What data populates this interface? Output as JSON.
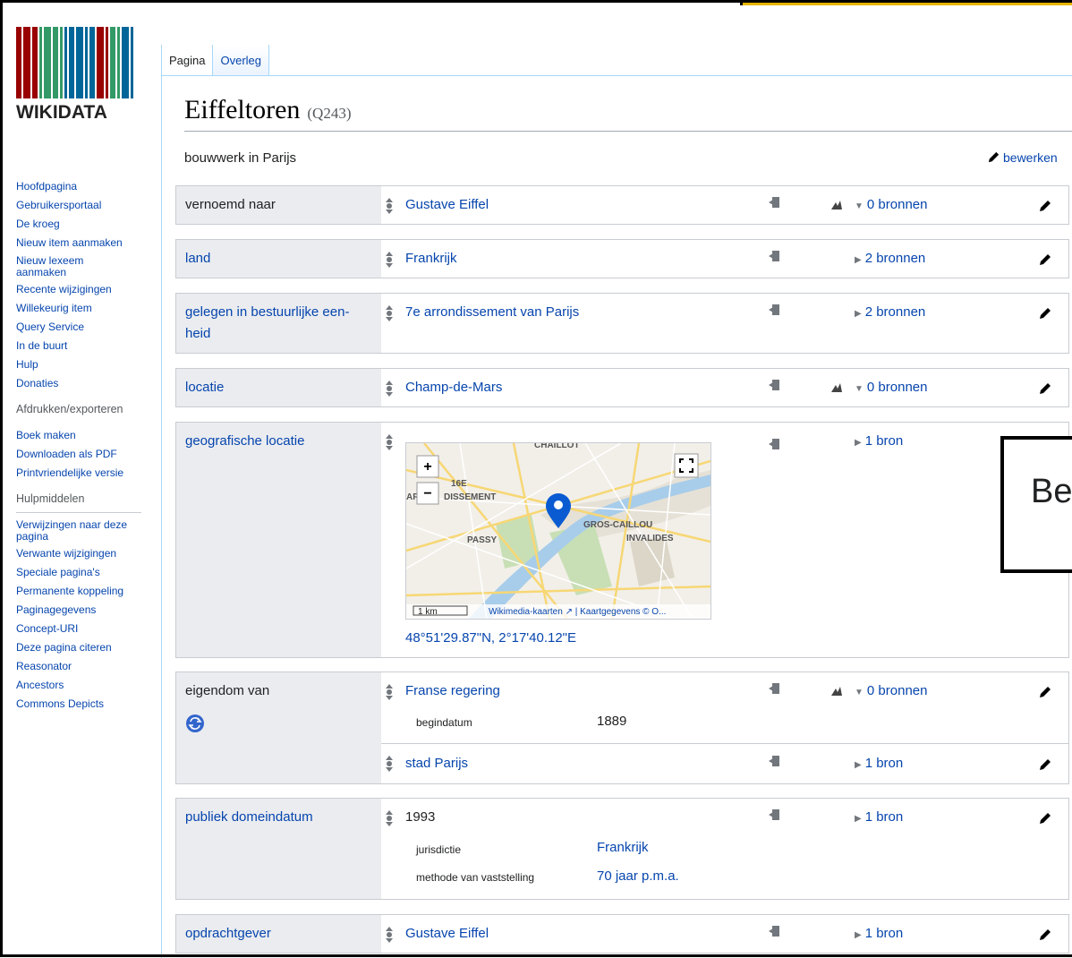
{
  "logo": {
    "text": "WIKIDATA"
  },
  "nav": {
    "main": [
      "Hoofdpagina",
      "Gebruikersportaal",
      "De kroeg",
      "Nieuw item aanmaken",
      "Nieuw lexeem aanmaken",
      "Recente wijzigingen",
      "Willekeurig item",
      "Query Service",
      "In de buurt",
      "Hulp",
      "Donaties"
    ],
    "print_head": "Afdrukken/exporteren",
    "print": [
      "Boek maken",
      "Downloaden als PDF",
      "Printvriendelijke versie"
    ],
    "tools_head": "Hulpmiddelen",
    "tools": [
      "Verwijzingen naar deze pagina",
      "Verwante wijzigingen",
      "Speciale pagina's",
      "Permanente koppeling",
      "Paginagegevens",
      "Concept-URI",
      "Deze pagina citeren",
      "Reasonator",
      "Ancestors",
      "Commons Depicts"
    ]
  },
  "tabs": {
    "page": "Pagina",
    "talk": "Overleg"
  },
  "item": {
    "title": "Eiffeltoren",
    "qid": "(Q243)",
    "description": "bouwwerk in Parijs",
    "edit": "bewerken"
  },
  "statements": [
    {
      "prop": "vernoemd naar",
      "value": "Gustave Eiffel",
      "refs": "0 bronnen"
    },
    {
      "prop": "land",
      "value": "Frankrijk",
      "refs": "2 bronnen"
    },
    {
      "prop": "gelegen in bestuurlijke een-heid",
      "prop_line1": "gelegen in bestuurlijke een-",
      "prop_line2": "heid",
      "value": "7e arrondissement van Parijs",
      "refs": "2 bronnen"
    },
    {
      "prop": "locatie",
      "value": "Champ-de-Mars",
      "refs": "0 bronnen"
    },
    {
      "prop": "geografische locatie",
      "value": "48°51'29.87\"N, 2°17'40.12\"E",
      "refs": "1 bron",
      "map": {
        "labels": [
          "CHAILLOT",
          "16E",
          "AR",
          "DISSEMENT",
          "GROS-CAILLOU",
          "INVALIDES",
          "PASSY"
        ],
        "scale": "1 km",
        "attribution": "Wikimedia-kaarten ↗ | Kaartgegevens © O...",
        "zoom_in": "+",
        "zoom_out": "−"
      }
    },
    {
      "prop": "eigendom van",
      "value": "Franse regering",
      "refs": "0 bronnen",
      "qualifier_key": "begindatum",
      "qualifier_value": "1889",
      "value2": "stad Parijs",
      "refs2": "1 bron"
    },
    {
      "prop": "publiek domeindatum",
      "value": "1993",
      "refs": "1 bron",
      "q1_key": "jurisdictie",
      "q1_value": "Frankrijk",
      "q2_key": "methode van vaststelling",
      "q2_value": "70 jaar p.m.a."
    },
    {
      "prop": "opdrachtgever",
      "value": "Gustave Eiffel",
      "refs": "1 bron"
    }
  ],
  "callout": {
    "text": "Be"
  },
  "colors": {
    "link": "#0645ad",
    "prop_bg": "#eaecf0",
    "border": "#c8ccd1",
    "marker": "#0a5bd1"
  }
}
